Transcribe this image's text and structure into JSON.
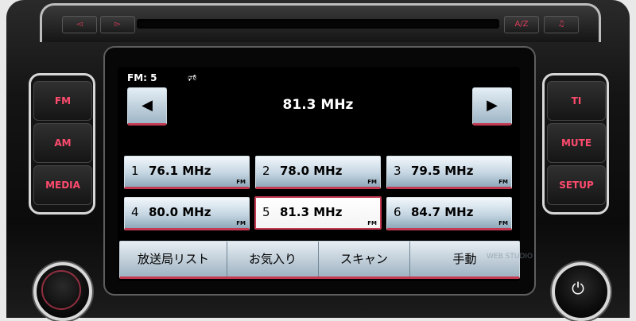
{
  "top_controls": {
    "prev_track": "◅",
    "next_track": "▻",
    "ab_label": "A/Z",
    "note_label": "♫"
  },
  "left_buttons": [
    "FM",
    "AM",
    "MEDIA"
  ],
  "right_buttons": [
    "TI",
    "MUTE",
    "SETUP"
  ],
  "screen": {
    "band_status": "FM: 5",
    "speaker_symbol": "🕫",
    "prev_arrow": "◀",
    "next_arrow": "▶",
    "current_frequency": "81.3 MHz"
  },
  "presets": [
    {
      "num": "1",
      "freq": "76.1 MHz",
      "band": "FM"
    },
    {
      "num": "2",
      "freq": "78.0 MHz",
      "band": "FM"
    },
    {
      "num": "3",
      "freq": "79.5 MHz",
      "band": "FM"
    },
    {
      "num": "4",
      "freq": "80.0 MHz",
      "band": "FM"
    },
    {
      "num": "5",
      "freq": "81.3 MHz",
      "band": "FM"
    },
    {
      "num": "6",
      "freq": "84.7 MHz",
      "band": "FM"
    }
  ],
  "bottom_tabs": [
    "放送局リスト",
    "お気入り",
    "スキャン",
    "手動"
  ],
  "power_symbol": "⏻",
  "watermark": "WEB STUDIO",
  "colors": {
    "accent": "#c43a52",
    "button_text": "#ff4b6e"
  }
}
